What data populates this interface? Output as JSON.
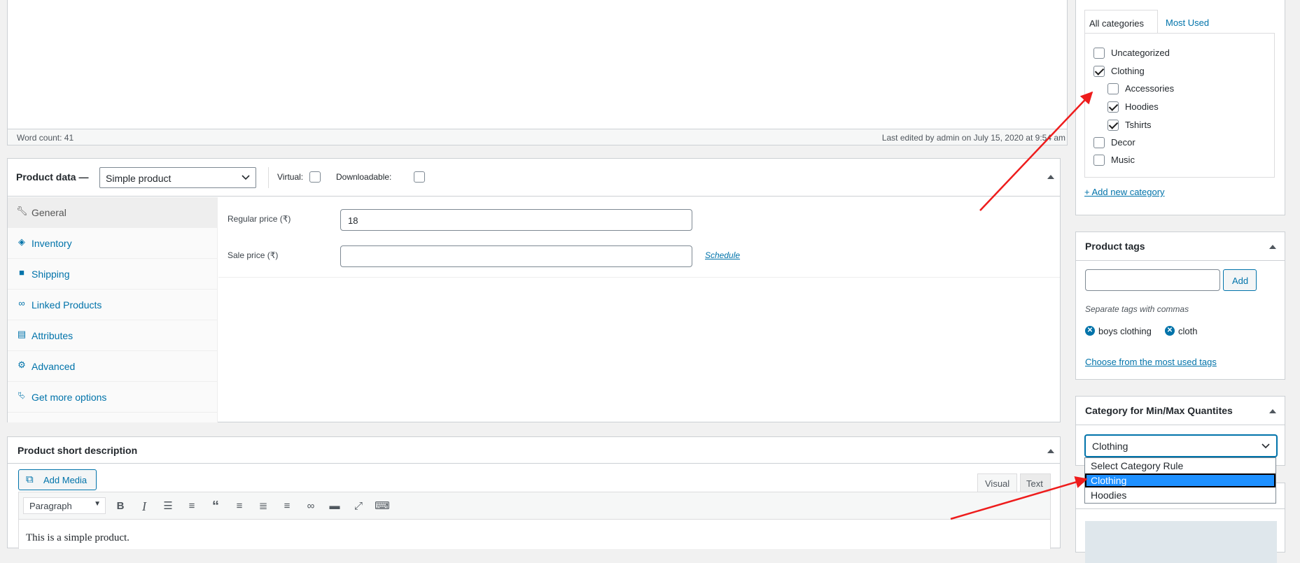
{
  "editor": {
    "word_count": "Word count: 41",
    "last_edited": "Last edited by admin on July 15, 2020 at 9:54 am"
  },
  "product_data": {
    "title": "Product data —",
    "type_value": "Simple product",
    "virtual_label": "Virtual:",
    "downloadable_label": "Downloadable:",
    "tabs": [
      {
        "label": "General",
        "icon": "wrench-icon"
      },
      {
        "label": "Inventory",
        "icon": "tag-icon"
      },
      {
        "label": "Shipping",
        "icon": "truck-icon"
      },
      {
        "label": "Linked Products",
        "icon": "link-icon"
      },
      {
        "label": "Attributes",
        "icon": "table-icon"
      },
      {
        "label": "Advanced",
        "icon": "gear-icon"
      },
      {
        "label": "Get more options",
        "icon": "plugin-icon"
      }
    ],
    "regular_price_label": "Regular price (₹)",
    "regular_price_value": "18",
    "sale_price_label": "Sale price (₹)",
    "sale_price_value": "",
    "schedule_link": "Schedule"
  },
  "short_description": {
    "title": "Product short description",
    "add_media": "Add Media",
    "tab_visual": "Visual",
    "tab_text": "Text",
    "format_select": "Paragraph",
    "content": "This is a simple product."
  },
  "categories": {
    "tab_all": "All categories",
    "tab_most_used": "Most Used",
    "items": [
      {
        "label": "Uncategorized",
        "checked": false
      },
      {
        "label": "Clothing",
        "checked": true
      },
      {
        "label": "Accessories",
        "checked": false
      },
      {
        "label": "Hoodies",
        "checked": true
      },
      {
        "label": "Tshirts",
        "checked": true
      },
      {
        "label": "Decor",
        "checked": false
      },
      {
        "label": "Music",
        "checked": false
      }
    ],
    "add_new": "+ Add new category"
  },
  "product_tags": {
    "title": "Product tags",
    "input_value": "",
    "add_button": "Add",
    "hint": "Separate tags with commas",
    "tags": [
      "boys clothing",
      "cloth"
    ],
    "choose_link": "Choose from the most used tags"
  },
  "minmax": {
    "title": "Category for Min/Max Quantites",
    "select_value": "Clothing",
    "options": [
      "Select Category Rule",
      "Clothing",
      "Hoodies"
    ],
    "selected_index": 1
  },
  "colors": {
    "accent": "#0073aa",
    "annotation_arrow": "#ee1c1c",
    "highlight": "#1e90ff"
  }
}
